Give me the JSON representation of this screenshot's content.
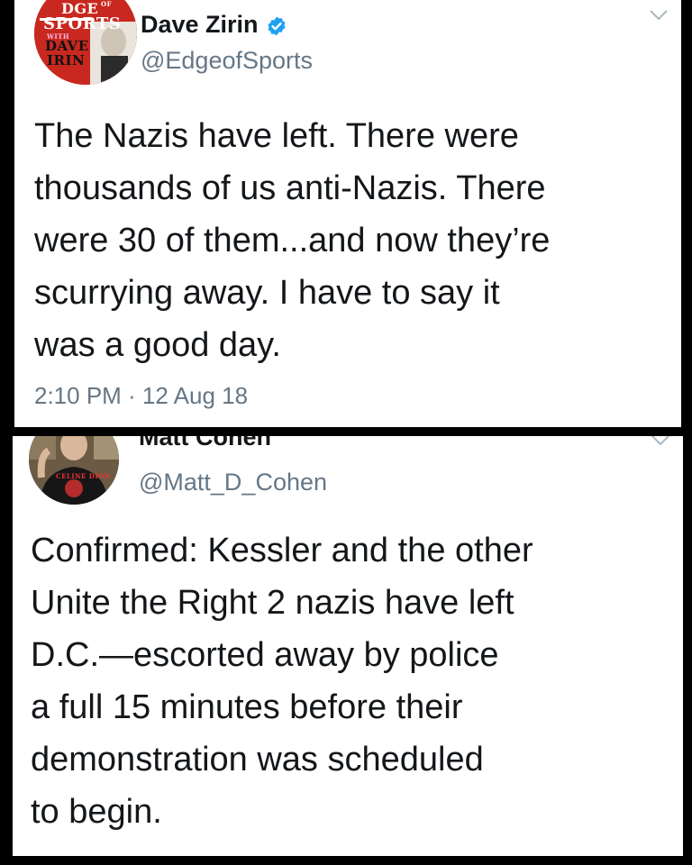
{
  "tweets": [
    {
      "display_name": "Dave Zirin",
      "verified": true,
      "handle": "@EdgeofSports",
      "text": "The Nazis have left. There were\nthousands of us anti-Nazis. There\nwere 30 of them...and now they’re\nscurrying away. I have to say it\nwas a good day.",
      "timestamp": "2:10 PM · 12 Aug 18",
      "avatar": {
        "line1": "DGE",
        "line1_small": "OF",
        "line2": "SPORTS",
        "line3": "WITH",
        "line4": "DAVE",
        "line5": "IRIN",
        "bg_color": "#c8281f"
      }
    },
    {
      "display_name": "Matt Cohen",
      "verified": false,
      "handle": "@Matt_D_Cohen",
      "text": "Confirmed: Kessler and the other\nUnite the Right 2 nazis have left\nD.C.—escorted away by police\na full 15 minutes before their\ndemonstration was scheduled\nto begin.",
      "avatar": {
        "shirt_text": "CELINE DION"
      }
    }
  ],
  "colors": {
    "background": "#000000",
    "card": "#ffffff",
    "name": "#14171a",
    "muted": "#657786",
    "verified": "#1da1f2"
  },
  "icons": [
    "verified-badge-icon",
    "chevron-down-icon"
  ]
}
